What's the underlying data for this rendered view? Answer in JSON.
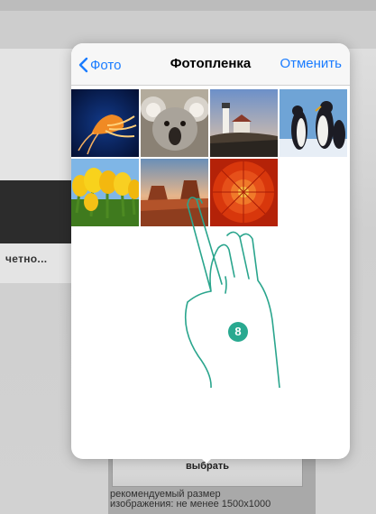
{
  "background": {
    "truncated_text": "четно...",
    "select_button_label": "выбрать",
    "hint_line1": "рекомендуемый размер",
    "hint_line2": "изображения: не менее 1500x1000"
  },
  "picker": {
    "back_label": "Фото",
    "title": "Фотопленка",
    "cancel_label": "Отменить",
    "accent_color": "#1a7cff",
    "photos": [
      {
        "subject": "jellyfish"
      },
      {
        "subject": "koala"
      },
      {
        "subject": "lighthouse"
      },
      {
        "subject": "penguins"
      },
      {
        "subject": "tulips"
      },
      {
        "subject": "desert"
      },
      {
        "subject": "chrysanthemum"
      }
    ]
  },
  "overlay": {
    "step_number": "8",
    "step_color": "#29a990"
  }
}
